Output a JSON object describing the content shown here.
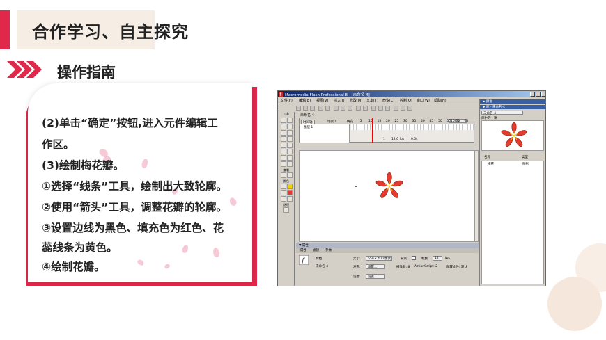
{
  "slide": {
    "title": "合作学习、自主探究",
    "section": "操作指南",
    "lines": [
      "(2)单击“确定”按钮,进入元件编辑工",
      "作区。",
      "(3)绘制梅花瓣。",
      "①选择“线条”工具，绘制出大致轮廓。",
      "②使用“箭头”工具，调整花瓣的轮廓。",
      "③设置边线为黑色、填充色为红色、花",
      "蕊线条为黄色。",
      "④绘制花瓣。"
    ],
    "colors": {
      "accent": "#e0294a",
      "title_bg": "#f6ede5",
      "petal": "#f3b7c8",
      "flower": "#e33b2e",
      "stamen": "#f5d200"
    }
  },
  "flash": {
    "title": "Macromedia Flash Professional 8 - [未命名-4]",
    "menu": [
      "文件(F)",
      "编辑(E)",
      "视图(V)",
      "插入(I)",
      "修改(M)",
      "文本(T)",
      "命令(C)",
      "控制(O)",
      "窗口(W)",
      "帮助(H)"
    ],
    "tools_label": "工具",
    "view_label": "查看",
    "colors_label": "颜色",
    "options_label": "选项",
    "doc_tab": "未命名-4",
    "timeline_btn": "时间轴",
    "scene": "场景 1",
    "symbol": "梅花",
    "zoom": "100%",
    "frame_numbers": [
      "1",
      "5",
      "10",
      "15",
      "20",
      "25",
      "30",
      "35",
      "40",
      "45",
      "50",
      "55",
      "60",
      "65"
    ],
    "layer_name": "图层 1",
    "status": [
      "1",
      "12.0 fps",
      "0.0s"
    ],
    "props": {
      "header": "▼ 属性",
      "tabs": [
        "属性",
        "滤镜",
        "参数"
      ],
      "doc_label": "文档",
      "doc_name": "未命名-4",
      "size_label": "大小:",
      "size_value": "550 x 400 像素",
      "bg_label": "背景:",
      "fps_label": "帧频:",
      "fps_value": "12",
      "fps_unit": "fps",
      "publish_label": "发布:",
      "settings_btn": "设置...",
      "player_label": "播放器: 8",
      "as_label": "ActionScript: 2",
      "profile_label": "配置文件: 默认",
      "device_label": "设备:",
      "device_btn": "设置..."
    },
    "right": {
      "color_head": "▶ 颜色",
      "lib_head": "▼ 库 - 未命名-4",
      "lib_doc": "未命名-4",
      "lib_count": "库中的一项",
      "col_name": "名称",
      "col_type": "类型",
      "item_name": "梅花",
      "item_type": "图形"
    }
  }
}
